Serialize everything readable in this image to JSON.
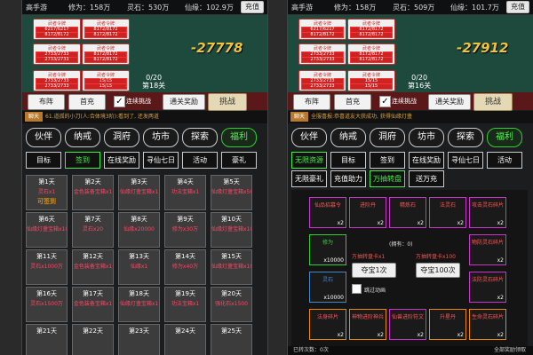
{
  "left": {
    "topbar": {
      "name": "高手游",
      "cultivation": "修为：158万",
      "stones": "灵石：530万",
      "immortal": "仙缘：102.9万",
      "charge": "充值"
    },
    "units": [
      {
        "name": "武者令牌",
        "hp": "6217/6217",
        "mp": "8172/8172"
      },
      {
        "name": "武者令牌",
        "hp": "2733/2733",
        "mp": "8172/8172"
      },
      {
        "name": "武者令牌",
        "hp": "2733/2733",
        "mp": "15/15"
      }
    ],
    "damage": "-27778",
    "wave_count": "0/20",
    "wave_level": "第18关",
    "actions": {
      "formation": "布阵",
      "first_charge": "首充",
      "auto_label": "连续挑战",
      "pass_reward": "通关奖励",
      "challenge": "挑战"
    },
    "chat": {
      "tag": "聊天",
      "message": "61.道孤的小刀(人:合体境3阶):看到了, 还发两道"
    },
    "menu": [
      "伙伴",
      "纳戒",
      "洞府",
      "坊市",
      "探索",
      "福利"
    ],
    "tabs1": [
      "目标",
      "签到",
      "在线奖励",
      "寻仙七日",
      "活动",
      "豪礼"
    ],
    "signin": [
      {
        "day": "第1天",
        "reward": "灵石x1",
        "claim": "可签到"
      },
      {
        "day": "第2天",
        "reward": "金色装备宝箱x1",
        "claim": ""
      },
      {
        "day": "第3天",
        "reward": "仙缘灯盏宝箱x1",
        "claim": ""
      },
      {
        "day": "第4天",
        "reward": "功法宝箱x1",
        "claim": ""
      },
      {
        "day": "第5天",
        "reward": "仙缘灯盏宝箱x50",
        "claim": ""
      },
      {
        "day": "第6天",
        "reward": "仙缘灯盏宝箱x10",
        "claim": ""
      },
      {
        "day": "第7天",
        "reward": "灵石x20",
        "claim": ""
      },
      {
        "day": "第8天",
        "reward": "仙缘x20000",
        "claim": ""
      },
      {
        "day": "第9天",
        "reward": "修为x30万",
        "claim": ""
      },
      {
        "day": "第10天",
        "reward": "仙缘灯盏宝箱x10",
        "claim": ""
      },
      {
        "day": "第11天",
        "reward": "灵石x1000万",
        "claim": ""
      },
      {
        "day": "第12天",
        "reward": "金色装备宝箱x1",
        "claim": ""
      },
      {
        "day": "第13天",
        "reward": "仙缘x1",
        "claim": ""
      },
      {
        "day": "第14天",
        "reward": "修为x40万",
        "claim": ""
      },
      {
        "day": "第15天",
        "reward": "仙缘灯盏宝箱x10",
        "claim": ""
      },
      {
        "day": "第16天",
        "reward": "灵石x1500万",
        "claim": ""
      },
      {
        "day": "第17天",
        "reward": "金色装备宝箱x1",
        "claim": ""
      },
      {
        "day": "第18天",
        "reward": "仙缘灯盏宝箱x1",
        "claim": ""
      },
      {
        "day": "第19天",
        "reward": "功法宝箱x1",
        "claim": ""
      },
      {
        "day": "第20天",
        "reward": "强化石x1500",
        "claim": ""
      },
      {
        "day": "第21天",
        "reward": "",
        "claim": ""
      },
      {
        "day": "第22天",
        "reward": "",
        "claim": ""
      },
      {
        "day": "第23天",
        "reward": "",
        "claim": ""
      },
      {
        "day": "第24天",
        "reward": "",
        "claim": ""
      },
      {
        "day": "第25天",
        "reward": "",
        "claim": ""
      }
    ]
  },
  "right": {
    "topbar": {
      "name": "高手游",
      "cultivation": "修为：158万",
      "stones": "灵石：509万",
      "immortal": "仙缘：101.7万",
      "charge": "充值"
    },
    "units": [
      {
        "name": "武者令牌",
        "hp": "6217/6217",
        "mp": "8172/8172"
      },
      {
        "name": "武者令牌",
        "hp": "2733/2733",
        "mp": "8172/8172"
      },
      {
        "name": "武者令牌",
        "hp": "2733/2733",
        "mp": "15/15"
      }
    ],
    "damage": "-27912",
    "wave_count": "0/20",
    "wave_level": "第16关",
    "actions": {
      "formation": "布阵",
      "first_charge": "首充",
      "auto_label": "连续挑战",
      "pass_reward": "通关奖励",
      "challenge": "挑战"
    },
    "chat": {
      "tag": "聊天",
      "message": "全服喜报:恭喜道友大获成功, 获得仙缘灯盏"
    },
    "menu": [
      "伙伴",
      "纳戒",
      "洞府",
      "坊市",
      "探索",
      "福利"
    ],
    "tabs1": [
      "无限资源",
      "目标",
      "签到",
      "在线奖励",
      "寻仙七日",
      "活动"
    ],
    "tabs2": [
      "无限豪礼",
      "充值助力",
      "万抽转盘",
      "送万充"
    ],
    "items_row1": [
      {
        "name": "仙品招募令",
        "qty": "x2"
      },
      {
        "name": "进阶丹",
        "qty": "x2"
      },
      {
        "name": "精炼石",
        "qty": "x2"
      },
      {
        "name": "法灵石",
        "qty": "x2"
      },
      {
        "name": "攻击灵石碎片",
        "qty": "x2"
      }
    ],
    "left_items": [
      {
        "name": "修为",
        "qty": "x10000"
      },
      {
        "name": "灵石",
        "qty": "x10000"
      }
    ],
    "right_items": [
      {
        "name": "物防灵石碎片",
        "qty": "x2"
      },
      {
        "name": "法防灵石碎片",
        "qty": "x2"
      }
    ],
    "owned": "(拥有：0)",
    "spin1_label": "万抽转盘卡x1",
    "spin1_btn": "夺宝1次",
    "spin100_label": "万抽转盘卡x100",
    "spin100_btn": "夺宝100次",
    "skip_anim": "跳过动画",
    "items_row3": [
      {
        "name": "法身碎片",
        "qty": "x2"
      },
      {
        "name": "神物进阶神兵",
        "qty": "x2"
      },
      {
        "name": "仙兽进阶符文",
        "qty": "x2"
      },
      {
        "name": "升星丹",
        "qty": "x2"
      },
      {
        "name": "生命灵石碎片",
        "qty": "x2"
      }
    ],
    "bottom_left": "已转次数：0次",
    "bottom_right": "全部奖励领取"
  }
}
